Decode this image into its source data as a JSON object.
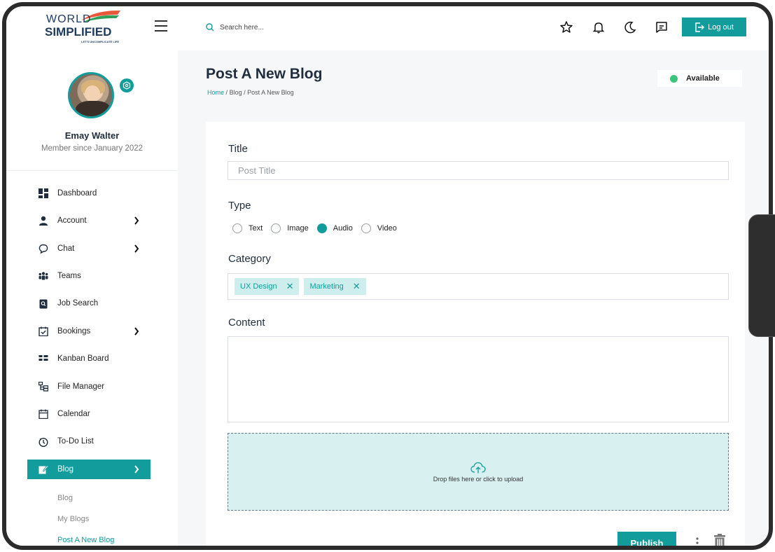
{
  "brand": {
    "line1": "WORLD",
    "line2": "SIMPLIFIED",
    "tagline": "LET'S UNCOMPLICATE LIFE"
  },
  "search": {
    "placeholder": "Search here..."
  },
  "header": {
    "logout_label": "Log out"
  },
  "user": {
    "name": "Emay Walter",
    "member_since": "Member since January 2022"
  },
  "sidebar": {
    "items": [
      {
        "label": "Dashboard",
        "icon": "dashboard-icon"
      },
      {
        "label": "Account",
        "icon": "user-icon"
      },
      {
        "label": "Chat",
        "icon": "chat-icon"
      },
      {
        "label": "Teams",
        "icon": "teams-icon"
      },
      {
        "label": "Job Search",
        "icon": "job-search-icon"
      },
      {
        "label": "Bookings",
        "icon": "bookings-icon"
      },
      {
        "label": "Kanban Board",
        "icon": "kanban-icon"
      },
      {
        "label": "File Manager",
        "icon": "file-manager-icon"
      },
      {
        "label": "Calendar",
        "icon": "calendar-icon"
      },
      {
        "label": "To-Do List",
        "icon": "timer-icon"
      },
      {
        "label": "Blog",
        "icon": "blog-edit-icon"
      }
    ],
    "blog_sub": [
      "Blog",
      "My Blogs",
      "Post A New Blog"
    ]
  },
  "page": {
    "title": "Post A New Blog",
    "breadcrumb": {
      "home": "Home",
      "sep": "/",
      "section": "Blog",
      "current": "Post A New Blog"
    },
    "status": "Available"
  },
  "form": {
    "title_label": "Title",
    "title_placeholder": "Post Title",
    "type_label": "Type",
    "types": [
      "Text",
      "Image",
      "Audio",
      "Video"
    ],
    "selected_type": "Audio",
    "category_label": "Category",
    "categories": [
      "UX Design",
      "Marketing"
    ],
    "content_label": "Content",
    "upload_text": "Drop files here or click to upload",
    "publish_label": "Publish"
  },
  "colors": {
    "accent": "#139c9c",
    "status_green": "#3bc47c",
    "tag_bg": "#cdeeed",
    "dropzone_bg": "#d8f0ef"
  }
}
